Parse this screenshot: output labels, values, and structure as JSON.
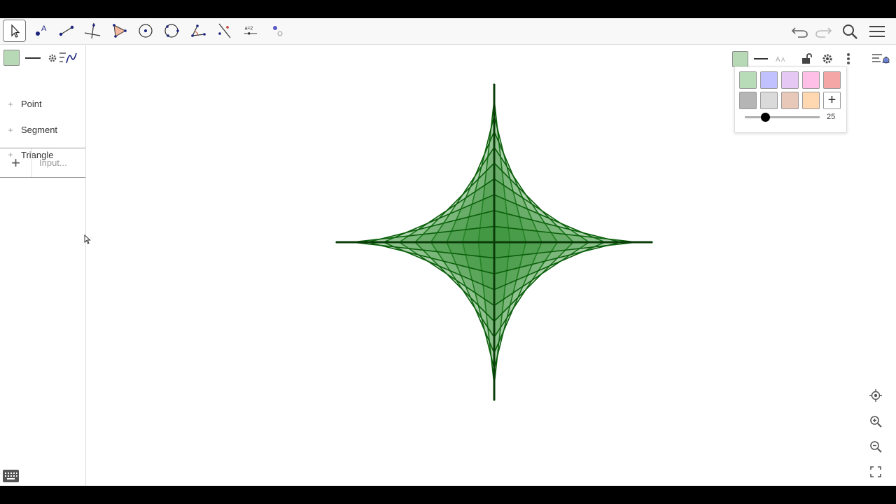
{
  "toolbar": {
    "tools": [
      "move-tool",
      "point-tool",
      "segment-tool",
      "perpendicular-line-tool",
      "polygon-tool",
      "circle-center-point-tool",
      "circle-three-points-tool",
      "angle-tool",
      "reflect-tool",
      "slider-tool",
      "more-tools"
    ],
    "slider_tool_label": "a=2"
  },
  "algebra": {
    "groups": [
      {
        "label": "Point"
      },
      {
        "label": "Segment"
      },
      {
        "label": "Triangle"
      }
    ],
    "input_placeholder": "Input..."
  },
  "style_popup": {
    "colors_row1": [
      "#b8dcb8",
      "#c1c1ff",
      "#e6c8f5",
      "#ffbfe6",
      "#f4a6a6"
    ],
    "colors_row2": [
      "#b5b5b5",
      "#dadada",
      "#e8c8b8",
      "#ffd7b0"
    ],
    "opacity_value": "25",
    "opacity_fraction": 0.25
  },
  "colors": {
    "shape_fill": "#2e8b2e",
    "shape_stroke": "#0a5f0a",
    "selected_fill": "#b7d9b6"
  }
}
